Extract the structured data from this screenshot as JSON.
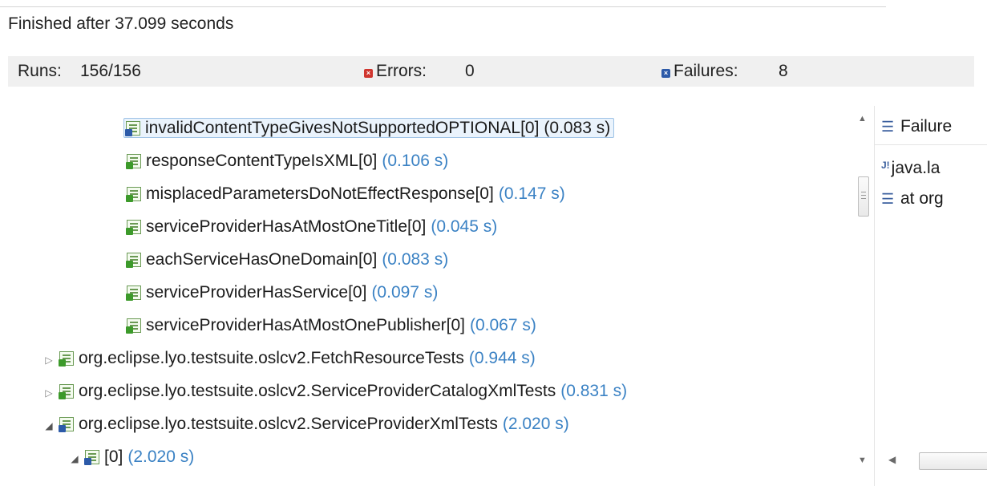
{
  "status": "Finished after 37.099 seconds",
  "stats": {
    "runs_label": "Runs:",
    "runs_value": "156/156",
    "errors_label": "Errors:",
    "errors_value": "0",
    "failures_label": "Failures:",
    "failures_value": "8"
  },
  "tree": [
    {
      "name": "invalidContentTypeGivesNotSupportedOPTIONAL[0]",
      "time": "(0.083 s)",
      "status": "failure",
      "selected": true
    },
    {
      "name": "responseContentTypeIsXML[0]",
      "time": "(0.106 s)",
      "status": "passed"
    },
    {
      "name": "misplacedParametersDoNotEffectResponse[0]",
      "time": "(0.147 s)",
      "status": "passed"
    },
    {
      "name": "serviceProviderHasAtMostOneTitle[0]",
      "time": "(0.045 s)",
      "status": "passed"
    },
    {
      "name": "eachServiceHasOneDomain[0]",
      "time": "(0.083 s)",
      "status": "passed"
    },
    {
      "name": "serviceProviderHasService[0]",
      "time": "(0.097 s)",
      "status": "passed"
    },
    {
      "name": "serviceProviderHasAtMostOnePublisher[0]",
      "time": "(0.067 s)",
      "status": "passed"
    },
    {
      "name": "org.eclipse.lyo.testsuite.oslcv2.FetchResourceTests",
      "time": "(0.944 s)",
      "status": "suite-passed",
      "expander": "collapsed"
    },
    {
      "name": "org.eclipse.lyo.testsuite.oslcv2.ServiceProviderCatalogXmlTests",
      "time": "(0.831 s)",
      "status": "suite-passed",
      "expander": "collapsed"
    },
    {
      "name": "org.eclipse.lyo.testsuite.oslcv2.ServiceProviderXmlTests",
      "time": "(2.020 s)",
      "status": "suite-failure",
      "expander": "expanded"
    },
    {
      "name": "[0]",
      "time": "(2.020 s)",
      "status": "suite-failure",
      "expander": "expanded"
    }
  ],
  "trace": {
    "header": "Failure",
    "lines": [
      "java.la",
      "at org"
    ]
  },
  "colors": {
    "time": "#3b82c4",
    "error": "#d0362f",
    "failure": "#2c5aa8",
    "pass": "#3c9a2a"
  }
}
